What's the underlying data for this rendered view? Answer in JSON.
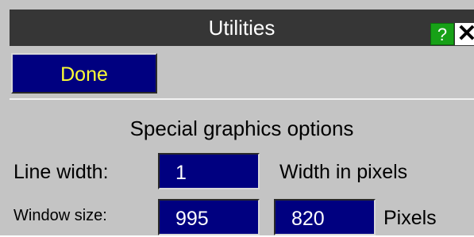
{
  "window": {
    "title": "Utilities"
  },
  "titlebar": {
    "help_label": "?",
    "close_label": "✕"
  },
  "toolbar": {
    "done_label": "Done"
  },
  "graphics": {
    "section_title": "Special graphics options",
    "line_width_label": "Line width:",
    "line_width_value": "1",
    "line_width_unit": "Width in pixels",
    "window_size_label": "Window size:",
    "window_width_value": "995",
    "window_height_value": "820",
    "window_size_unit": "Pixels"
  },
  "colors": {
    "titlebar": "#363636",
    "panel": "#c4c4c4",
    "field_bg": "#000080",
    "done_text": "#ffff33",
    "help_bg": "#17a117"
  }
}
